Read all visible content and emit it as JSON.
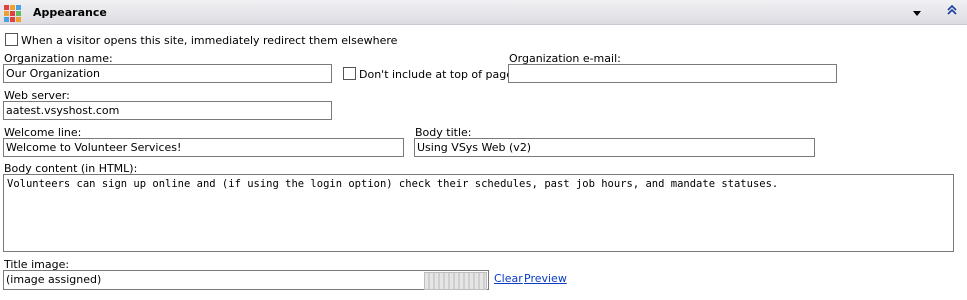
{
  "header": {
    "title": "Appearance",
    "logo_colors": [
      "#e04040",
      "#f0a030",
      "#4aa0e0",
      "#e04040",
      "#60c060",
      "#4aa0e0",
      "#f0a030",
      "#e04040",
      "#60c060"
    ]
  },
  "redirect": {
    "label": "When a visitor opens this site, immediately redirect them elsewhere",
    "checked": false
  },
  "org_name": {
    "label": "Organization name:",
    "value": "Our Organization"
  },
  "dont_include": {
    "label": "Don't include at top of page",
    "checked": false
  },
  "org_email": {
    "label": "Organization e-mail:",
    "value": ""
  },
  "web_server": {
    "label": "Web server:",
    "value": "aatest.vsyshost.com"
  },
  "welcome": {
    "label": "Welcome line:",
    "value": "Welcome to Volunteer Services!"
  },
  "body_title": {
    "label": "Body title:",
    "value": "Using VSys Web (v2)"
  },
  "body_content": {
    "label": "Body content (in HTML):",
    "value": "Volunteers can sign up online and (if using the login option) check their schedules, past job hours, and mandate statuses."
  },
  "title_image": {
    "label": "Title image:",
    "value": "(image assigned)",
    "clear_label": "Clear",
    "preview_label": "Preview"
  }
}
